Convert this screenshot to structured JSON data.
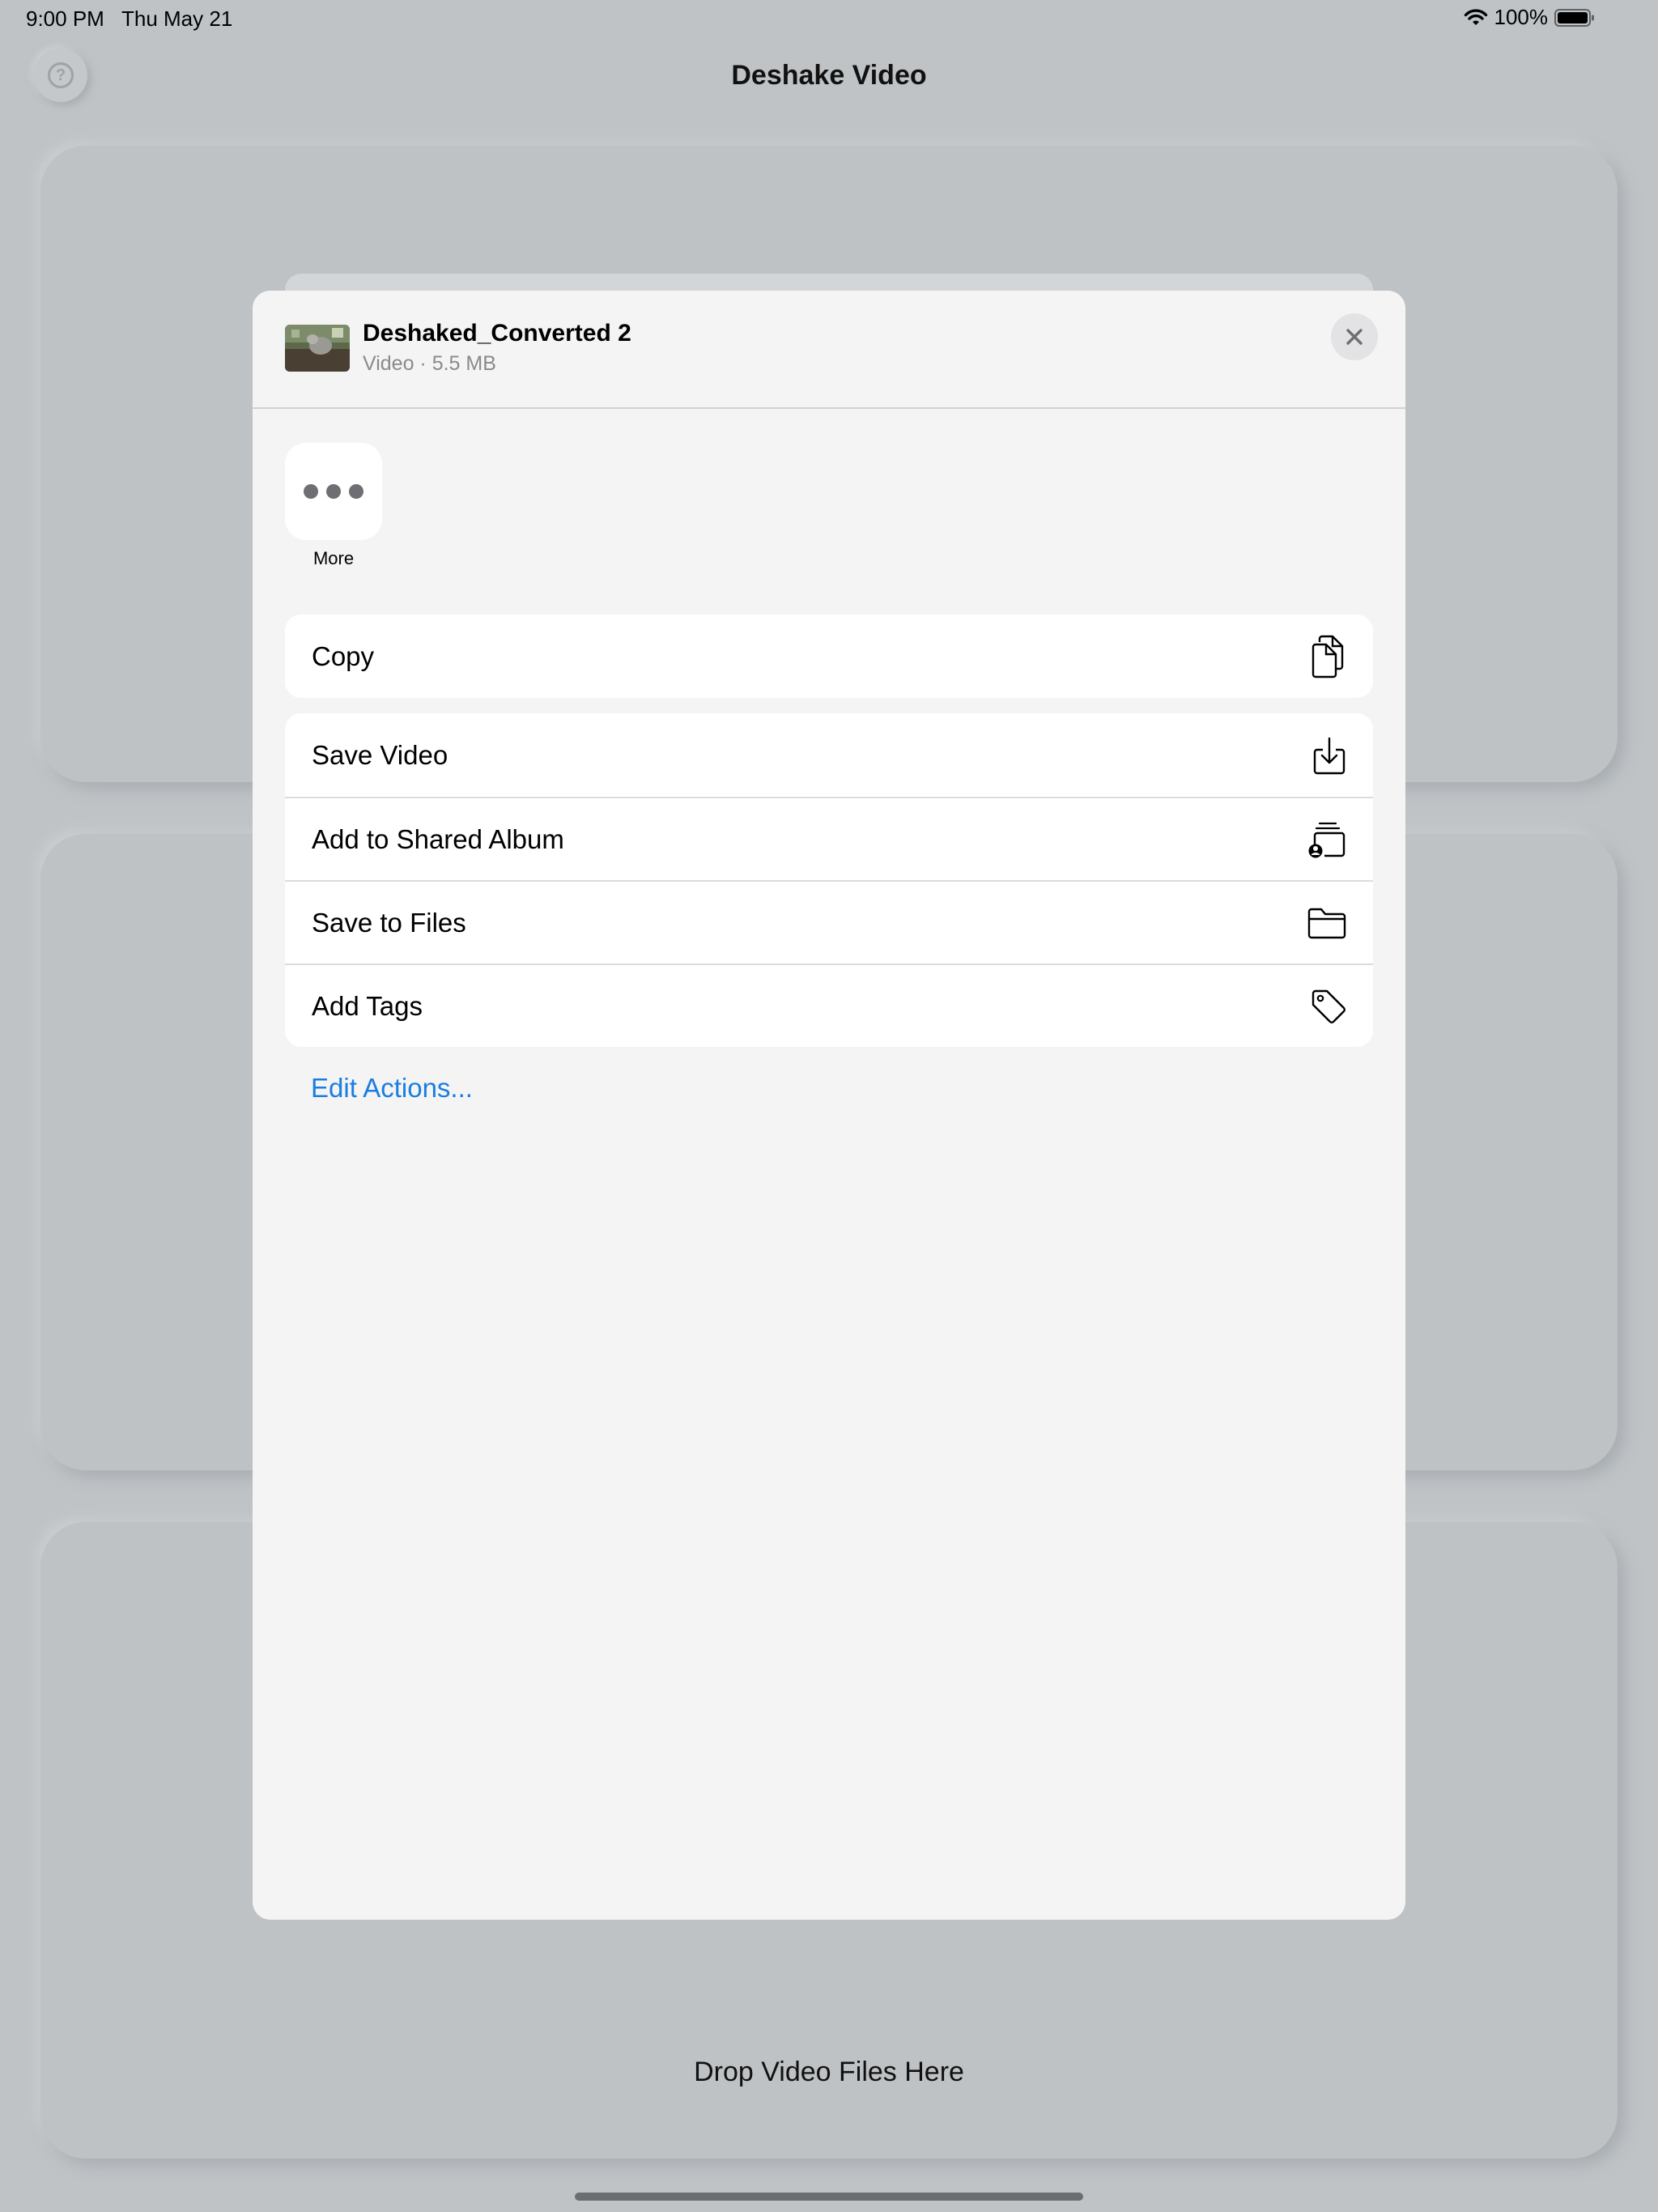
{
  "status_bar": {
    "time": "9:00 PM",
    "date": "Thu May 21",
    "battery": "100%"
  },
  "app": {
    "title": "Deshake Video",
    "drop_label": "Drop Video Files Here"
  },
  "share_sheet": {
    "file_name": "Deshaked_Converted 2",
    "file_meta": "Video · 5.5 MB",
    "more_label": "More",
    "group1": [
      {
        "label": "Copy",
        "icon": "copy-icon"
      }
    ],
    "group2": [
      {
        "label": "Save Video",
        "icon": "save-video-icon"
      },
      {
        "label": "Add to Shared Album",
        "icon": "shared-album-icon"
      },
      {
        "label": "Save to Files",
        "icon": "folder-icon"
      },
      {
        "label": "Add Tags",
        "icon": "tag-icon"
      }
    ],
    "edit_actions": "Edit Actions..."
  },
  "colors": {
    "accent": "#1a7ee0",
    "background": "#bfc3c6",
    "sheet": "#f4f4f4"
  }
}
